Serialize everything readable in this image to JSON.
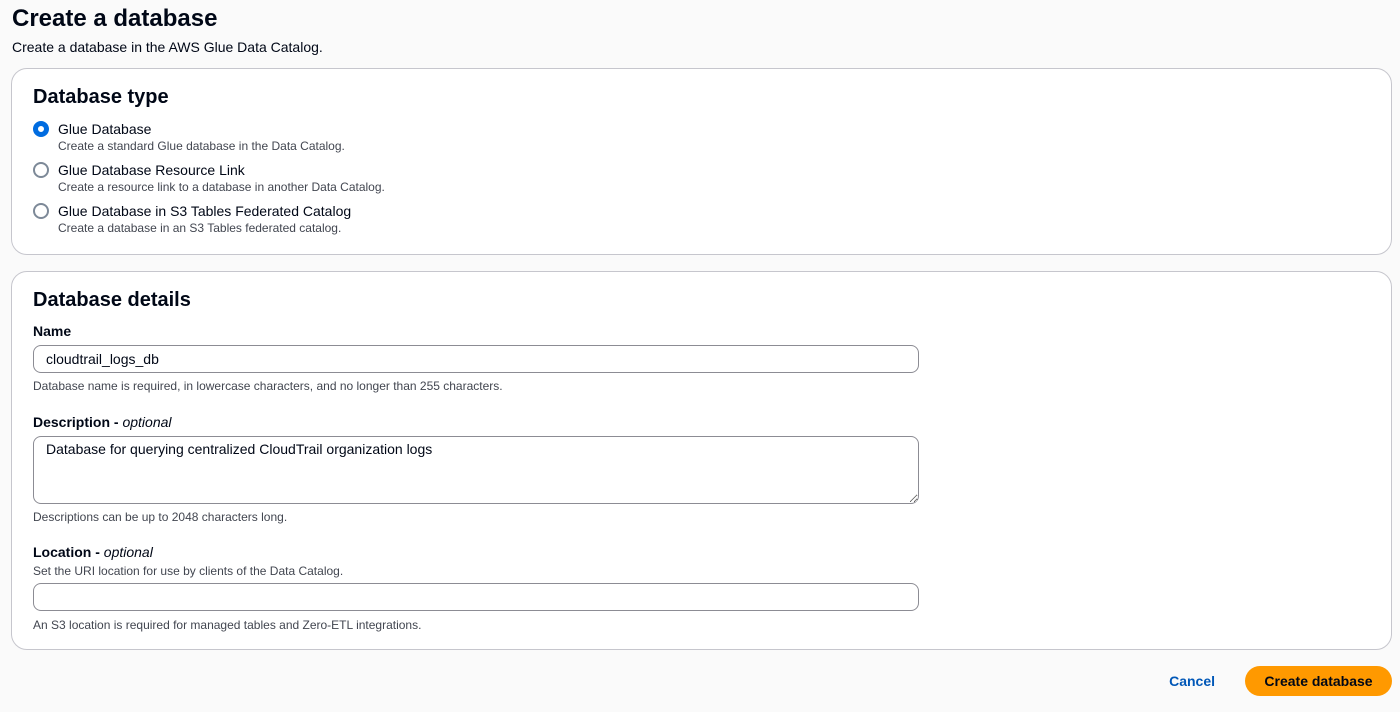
{
  "header": {
    "title": "Create a database",
    "subtitle": "Create a database in the AWS Glue Data Catalog."
  },
  "database_type": {
    "heading": "Database type",
    "options": [
      {
        "label": "Glue Database",
        "description": "Create a standard Glue database in the Data Catalog.",
        "selected": true
      },
      {
        "label": "Glue Database Resource Link",
        "description": "Create a resource link to a database in another Data Catalog.",
        "selected": false
      },
      {
        "label": "Glue Database in S3 Tables Federated Catalog",
        "description": "Create a database in an S3 Tables federated catalog.",
        "selected": false
      }
    ]
  },
  "database_details": {
    "heading": "Database details",
    "name": {
      "label": "Name",
      "value": "cloudtrail_logs_db",
      "help": "Database name is required, in lowercase characters, and no longer than 255 characters."
    },
    "description": {
      "label": "Description - ",
      "optional": "optional",
      "value": "Database for querying centralized CloudTrail organization logs",
      "help": "Descriptions can be up to 2048 characters long."
    },
    "location": {
      "label": "Location - ",
      "optional": "optional",
      "constraint": "Set the URI location for use by clients of the Data Catalog.",
      "value": "",
      "help": "An S3 location is required for managed tables and Zero-ETL integrations."
    }
  },
  "actions": {
    "cancel_label": "Cancel",
    "create_label": "Create database"
  },
  "colors": {
    "primary_button": "#ff9900",
    "link": "#0057b7",
    "radio_selected": "#006ce0"
  }
}
